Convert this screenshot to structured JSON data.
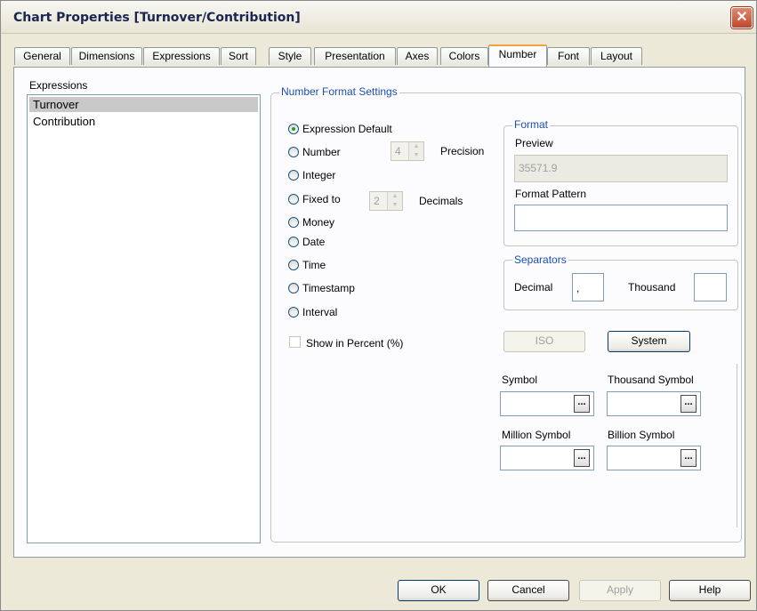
{
  "window": {
    "title": "Chart Properties [Turnover/Contribution]",
    "close_glyph": "✕"
  },
  "tabs": [
    "General",
    "Dimensions",
    "Expressions",
    "Sort",
    "Style",
    "Presentation",
    "Axes",
    "Colors",
    "Number",
    "Font",
    "Layout"
  ],
  "active_tab": "Number",
  "expressions": {
    "label": "Expressions",
    "items": [
      "Turnover",
      "Contribution"
    ],
    "selected": "Turnover"
  },
  "number_format": {
    "group_title": "Number Format Settings",
    "options": [
      "Expression Default",
      "Number",
      "Integer",
      "Fixed to",
      "Money",
      "Date",
      "Time",
      "Timestamp",
      "Interval"
    ],
    "selected": "Expression Default",
    "precision_value": "4",
    "precision_label": "Precision",
    "decimals_value": "2",
    "decimals_label": "Decimals",
    "show_percent_label": "Show in Percent (%)"
  },
  "format": {
    "group_title": "Format",
    "preview_label": "Preview",
    "preview_value": "35571.9",
    "pattern_label": "Format Pattern",
    "pattern_value": ""
  },
  "separators": {
    "group_title": "Separators",
    "decimal_label": "Decimal",
    "decimal_value": ",",
    "thousand_label": "Thousand",
    "thousand_value": ""
  },
  "buttons": {
    "iso": "ISO",
    "system": "System",
    "browse": "...",
    "ok": "OK",
    "cancel": "Cancel",
    "apply": "Apply",
    "help": "Help"
  },
  "symbols": {
    "symbol_label": "Symbol",
    "thousand_symbol_label": "Thousand Symbol",
    "million_symbol_label": "Million Symbol",
    "billion_symbol_label": "Billion Symbol"
  }
}
